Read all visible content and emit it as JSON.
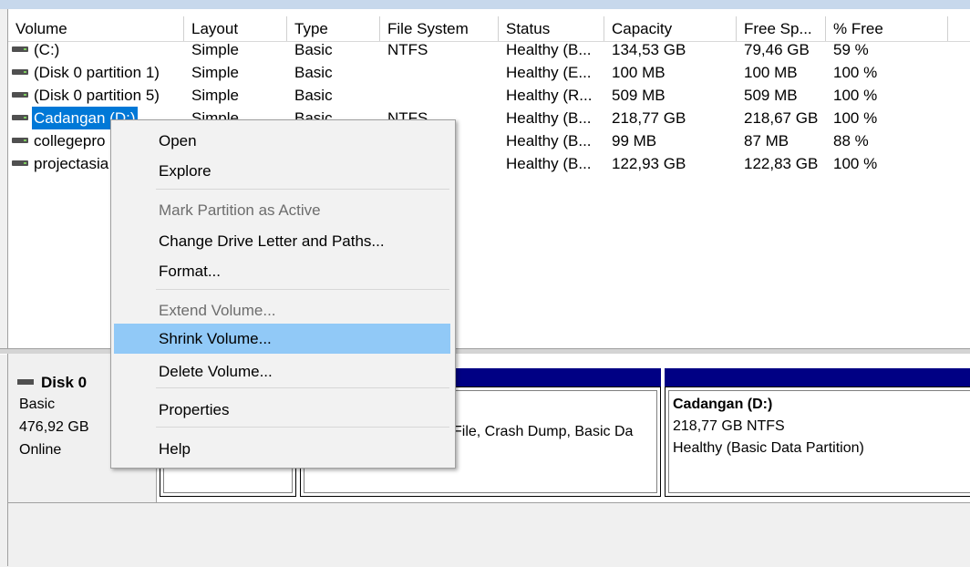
{
  "columns": [
    {
      "label": "Volume"
    },
    {
      "label": "Layout"
    },
    {
      "label": "Type"
    },
    {
      "label": "File System"
    },
    {
      "label": "Status"
    },
    {
      "label": "Capacity"
    },
    {
      "label": "Free Sp..."
    },
    {
      "label": "% Free"
    }
  ],
  "volumes": [
    {
      "name": " (C:)",
      "layout": "Simple",
      "type": "Basic",
      "fs": "NTFS",
      "status": "Healthy (B...",
      "capacity": "134,53 GB",
      "free": "79,46 GB",
      "pct": "59 %"
    },
    {
      "name": "(Disk 0 partition 1)",
      "layout": "Simple",
      "type": "Basic",
      "fs": "",
      "status": "Healthy (E...",
      "capacity": "100 MB",
      "free": "100 MB",
      "pct": "100 %"
    },
    {
      "name": "(Disk 0 partition 5)",
      "layout": "Simple",
      "type": "Basic",
      "fs": "",
      "status": "Healthy (R...",
      "capacity": "509 MB",
      "free": "509 MB",
      "pct": "100 %"
    },
    {
      "name": "Cadangan (D:)",
      "layout": "Simple",
      "type": "Basic",
      "fs": "NTFS",
      "status": "Healthy (B...",
      "capacity": "218,77 GB",
      "free": "218,67 GB",
      "pct": "100 %"
    },
    {
      "name": "collegepro",
      "layout": "",
      "type": "",
      "fs": "",
      "status": "Healthy (B...",
      "capacity": "99 MB",
      "free": "87 MB",
      "pct": "88 %"
    },
    {
      "name": "projectasia",
      "layout": "",
      "type": "",
      "fs": "",
      "status": "Healthy (B...",
      "capacity": "122,93 GB",
      "free": "122,83 GB",
      "pct": "100 %"
    }
  ],
  "context_menu": {
    "items": [
      {
        "label": "Open",
        "enabled": true
      },
      {
        "label": "Explore",
        "enabled": true
      },
      {
        "label": "Mark Partition as Active",
        "enabled": false
      },
      {
        "label": "Change Drive Letter and Paths...",
        "enabled": true
      },
      {
        "label": "Format...",
        "enabled": true
      },
      {
        "label": "Extend Volume...",
        "enabled": false
      },
      {
        "label": "Shrink Volume...",
        "enabled": true,
        "highlighted": true
      },
      {
        "label": "Delete Volume...",
        "enabled": true
      },
      {
        "label": "Properties",
        "enabled": true
      },
      {
        "label": "Help",
        "enabled": true
      }
    ]
  },
  "disk": {
    "name": "Disk 0",
    "type": "Basic",
    "size": "476,92 GB",
    "state": "Online"
  },
  "partitions": {
    "c_drive_text": "File, Crash Dump, Basic Da",
    "d_drive": {
      "name": "Cadangan  (D:)",
      "size_fs": "218,77 GB NTFS",
      "status": "Healthy (Basic Data Partition)"
    }
  },
  "colors": {
    "selection": "#0078d7",
    "menu_highlight": "#91c9f7",
    "partition_bar": "#000084"
  }
}
